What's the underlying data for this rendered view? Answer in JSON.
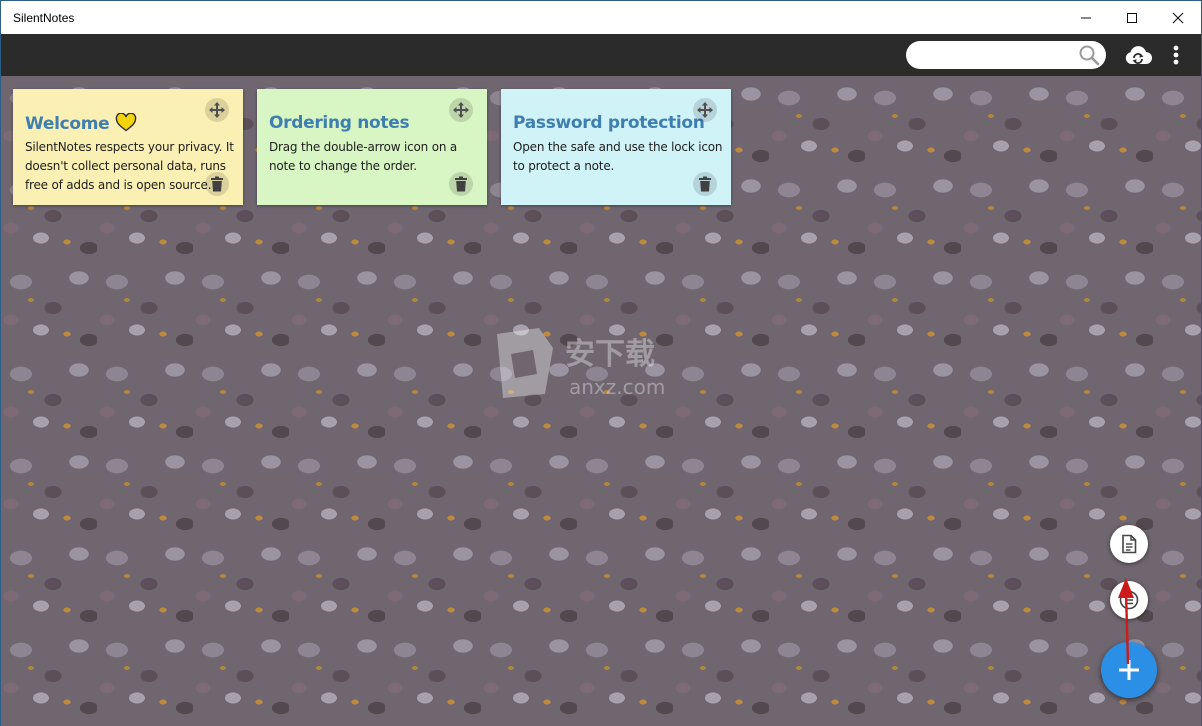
{
  "window": {
    "title": "SilentNotes"
  },
  "toolbar": {
    "search_placeholder": "",
    "search_value": ""
  },
  "notes": [
    {
      "title": "Welcome",
      "body": "SilentNotes respects your privacy. It doesn't collect personal data, runs free of adds and is open source.",
      "color": "#fbf0b3",
      "has_heart": true
    },
    {
      "title": "Ordering notes",
      "body": "Drag the double-arrow icon on a note to change the order.",
      "color": "#d8f5c4"
    },
    {
      "title": "Password protection",
      "body": "Open the safe and use the lock icon to protect a note.",
      "color": "#d0f3f8"
    }
  ],
  "colors": {
    "titlebar": "#ffffff",
    "toolbar": "#2b2b2b",
    "note_title": "#3f7fb0",
    "fab_blue": "#2b8fe6",
    "annotation_arrow": "#cc1b1b"
  },
  "watermark": {
    "cn_text": "安下载",
    "latin_text": "anxz.com"
  },
  "icons": {
    "minimize": "minimize-icon",
    "maximize": "maximize-icon",
    "close": "close-icon",
    "search": "search-icon",
    "sync": "cloud-sync-icon",
    "menu": "more-vertical-icon",
    "move": "move-arrows-icon",
    "delete": "trash-icon",
    "new_note": "document-icon",
    "new_checklist": "checklist-icon",
    "add": "plus-icon"
  }
}
